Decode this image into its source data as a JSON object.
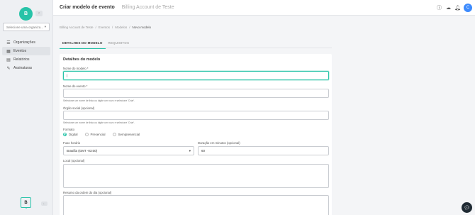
{
  "sidebar": {
    "logo_letter": "B",
    "collapse_icon": "‹",
    "org_select_placeholder": "Selecione uma organiza...",
    "items": [
      {
        "label": "Organizações",
        "icon": "list-icon"
      },
      {
        "label": "Eventos",
        "icon": "calendar-icon"
      },
      {
        "label": "Relatórios",
        "icon": "report-icon"
      },
      {
        "label": "Assinaturas",
        "icon": "signature-icon"
      }
    ],
    "chat_badge_letter": "B"
  },
  "header": {
    "title": "Criar modelo de evento",
    "account": "Billing Account de Teste",
    "avatar_letter": "C"
  },
  "breadcrumb": [
    "Billing Account de Teste",
    "/",
    "Eventos",
    "/",
    "Modelos",
    "/",
    "Novo modelo"
  ],
  "tabs": [
    {
      "label": "DETALHES DO MODELO",
      "active": true
    },
    {
      "label": "REQUISITOS",
      "active": false
    }
  ],
  "form": {
    "section_title": "Detalhes do modelo",
    "template_name_label": "Nome do modelo *",
    "template_name_value": "|",
    "event_name_label": "Nome do evento *",
    "event_name_hint": "Selecione um nome de lista ou digite um novo e selecione 'Criar'.",
    "org_label": "Órgão social (opcional)",
    "org_hint": "Selecione um nome de lista ou digite um novo e selecione 'Criar'.",
    "format_label": "Formato",
    "format_options": [
      "Digital",
      "Presencial",
      "Semipresencial"
    ],
    "timezone_label": "Fuso horário",
    "timezone_value": "Brasília (GMT -03:00)",
    "duration_label": "Duração em minutos (opcional)",
    "duration_value": "60",
    "location_label": "Local (opcional)",
    "agenda_label": "Resumo da ordem do dia (opcional)"
  }
}
